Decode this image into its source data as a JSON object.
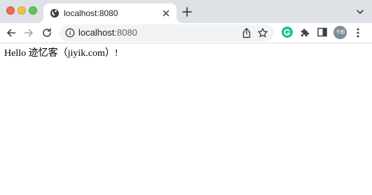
{
  "tab": {
    "title": "localhost:8080",
    "favicon": "globe-icon",
    "close_icon": "close-icon"
  },
  "tabstrip": {
    "new_tab_icon": "plus-icon",
    "tab_menu_icon": "chevron-down-icon"
  },
  "toolbar": {
    "back_icon": "arrow-left-icon",
    "forward_icon": "arrow-right-icon",
    "reload_icon": "reload-icon",
    "omnibox": {
      "host": "localhost",
      "port": ":8080",
      "info_icon": "info-icon",
      "share_icon": "share-icon",
      "bookmark_icon": "star-icon"
    },
    "extensions": {
      "grammarly_icon": "grammarly-icon",
      "puzzle_icon": "puzzle-icon",
      "side_panel_icon": "side-panel-icon"
    },
    "profile": {
      "avatar_text": "千郎"
    },
    "menu_icon": "kebab-menu-icon"
  },
  "page": {
    "body_text": "Hello 迹忆客（jiyik.com）!"
  },
  "colors": {
    "tabstrip_bg": "#dee1e6",
    "omnibox_bg": "#f1f3f4",
    "traffic_red": "#ed6a5e",
    "traffic_yellow": "#f5bf4f",
    "traffic_green": "#61c554",
    "grammarly_green": "#15c39a",
    "avatar_bg": "#7c8c98"
  }
}
